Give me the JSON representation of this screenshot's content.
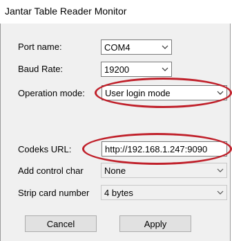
{
  "window": {
    "title": "Jantar Table Reader Monitor"
  },
  "fields": {
    "port_name": {
      "label": "Port name:",
      "value": "COM4"
    },
    "baud_rate": {
      "label": "Baud Rate:",
      "value": "19200"
    },
    "operation_mode": {
      "label": "Operation mode:",
      "value": "User login mode"
    },
    "codeks_url": {
      "label": "Codeks URL:",
      "value": "http://192.168.1.247:9090"
    },
    "add_control_char": {
      "label": "Add control char",
      "value": "None"
    },
    "strip_card_number": {
      "label": "Strip card number",
      "value": "4 bytes"
    }
  },
  "buttons": {
    "cancel": "Cancel",
    "apply": "Apply"
  },
  "colors": {
    "highlight_ellipse": "#c0202a",
    "dialog_bg": "#f0f0f0"
  }
}
